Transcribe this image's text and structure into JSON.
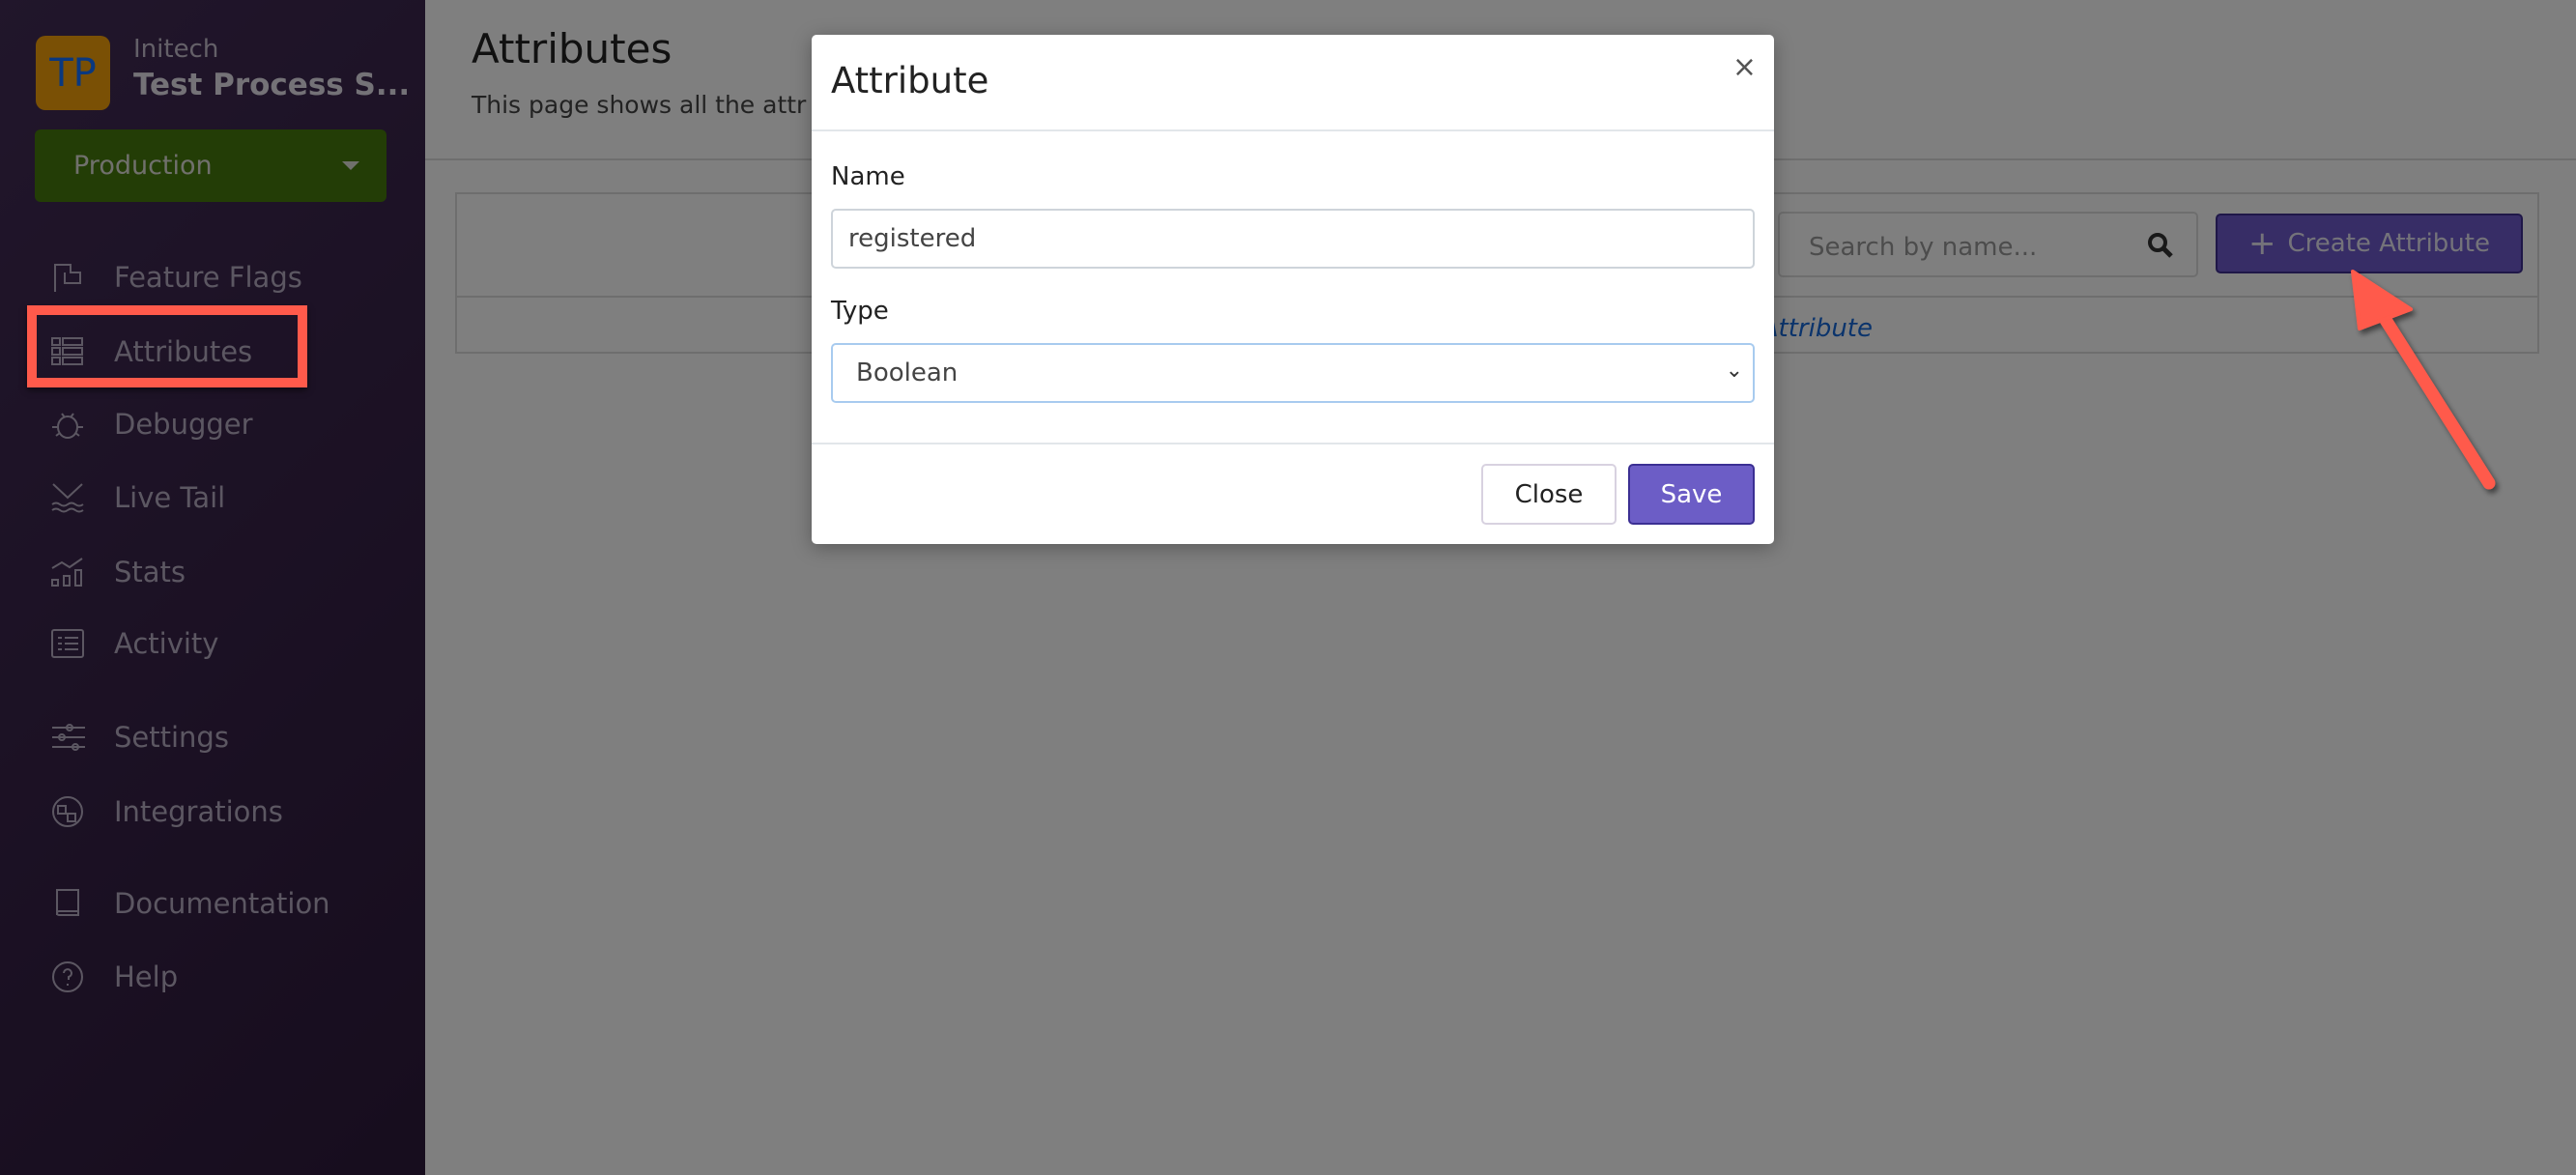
{
  "sidebar": {
    "logo_initials": "TP",
    "logo_color": "#f4a00a",
    "org": "Initech",
    "project": "Test Process S...",
    "environment": "Production",
    "environment_color": "#467a0c",
    "items": [
      {
        "label": "Feature Flags",
        "icon": "flag-icon"
      },
      {
        "label": "Attributes",
        "icon": "attributes-list-icon",
        "active": true
      },
      {
        "label": "Debugger",
        "icon": "bug-icon"
      },
      {
        "label": "Live Tail",
        "icon": "whale-tail-icon"
      },
      {
        "label": "Stats",
        "icon": "chart-icon"
      },
      {
        "label": "Activity",
        "icon": "activity-list-icon"
      },
      {
        "label": "Settings",
        "icon": "sliders-icon"
      },
      {
        "label": "Integrations",
        "icon": "puzzle-icon"
      },
      {
        "label": "Documentation",
        "icon": "book-icon"
      },
      {
        "label": "Help",
        "icon": "question-circle-icon"
      }
    ]
  },
  "main": {
    "title": "Attributes",
    "subtitle": "This page shows all the attr",
    "search_placeholder": "Search by name...",
    "create_label": "Create Attribute",
    "create_color": "#6e5acc",
    "empty_link": "Attribute"
  },
  "modal": {
    "title": "Attribute",
    "close_icon": "×",
    "name_label": "Name",
    "name_value": "registered",
    "type_label": "Type",
    "type_value": "Boolean",
    "close_label": "Close",
    "save_label": "Save",
    "save_color": "#6c5dc6"
  },
  "annotation_color": "#ff5a4b"
}
